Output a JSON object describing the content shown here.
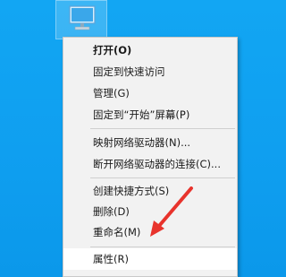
{
  "desktop": {
    "icon_name": "monitor-icon"
  },
  "context_menu": {
    "items": [
      {
        "label": "打开(O)"
      },
      {
        "label": "固定到快速访问"
      },
      {
        "label": "管理(G)"
      },
      {
        "label": "固定到“开始”屏幕(P)"
      },
      {
        "label": "映射网络驱动器(N)..."
      },
      {
        "label": "断开网络驱动器的连接(C)..."
      },
      {
        "label": "创建快捷方式(S)"
      },
      {
        "label": "删除(D)"
      },
      {
        "label": "重命名(M)"
      },
      {
        "label": "属性(R)"
      }
    ]
  },
  "colors": {
    "desktop_blue": "#0f9ff0",
    "menu_bg": "#f2f2f2",
    "highlight": "#ffffff",
    "annotation_arrow": "#e8332c"
  }
}
